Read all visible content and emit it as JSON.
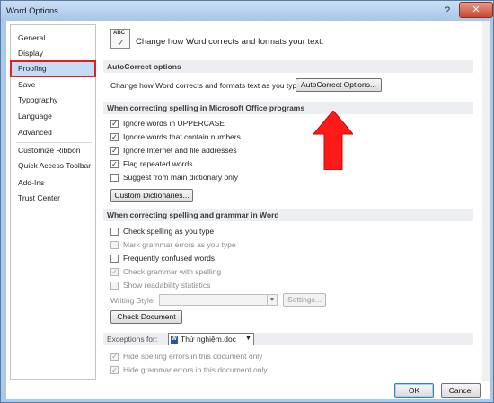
{
  "window": {
    "title": "Word Options",
    "help_glyph": "?",
    "close_glyph": "✕"
  },
  "nav": {
    "items": [
      {
        "label": "General"
      },
      {
        "label": "Display"
      },
      {
        "label": "Proofing"
      },
      {
        "label": "Save"
      },
      {
        "label": "Typography"
      },
      {
        "label": "Language"
      },
      {
        "label": "Advanced"
      },
      {
        "label": "Customize Ribbon"
      },
      {
        "label": "Quick Access Toolbar"
      },
      {
        "label": "Add-Ins"
      },
      {
        "label": "Trust Center"
      }
    ],
    "selected": "Proofing"
  },
  "header": {
    "icon_text": "ABC",
    "title": "Change how Word corrects and formats your text."
  },
  "autocorrect": {
    "section_title": "AutoCorrect options",
    "description": "Change how Word corrects and formats text as you type:",
    "button_label": "AutoCorrect Options..."
  },
  "office_spelling": {
    "section_title": "When correcting spelling in Microsoft Office programs",
    "options": [
      {
        "label": "Ignore words in UPPERCASE",
        "checked": true
      },
      {
        "label": "Ignore words that contain numbers",
        "checked": true
      },
      {
        "label": "Ignore Internet and file addresses",
        "checked": true
      },
      {
        "label": "Flag repeated words",
        "checked": true
      },
      {
        "label": "Suggest from main dictionary only",
        "checked": false
      }
    ],
    "button_label": "Custom Dictionaries..."
  },
  "word_spelling": {
    "section_title": "When correcting spelling and grammar in Word",
    "options": [
      {
        "label": "Check spelling as you type",
        "checked": false,
        "disabled": false
      },
      {
        "label": "Mark grammar errors as you type",
        "checked": false,
        "disabled": true
      },
      {
        "label": "Frequently confused words",
        "checked": false,
        "disabled": false
      },
      {
        "label": "Check grammar with spelling",
        "checked": true,
        "disabled": true
      },
      {
        "label": "Show readability statistics",
        "checked": false,
        "disabled": true
      }
    ],
    "writing_style_label": "Writing Style:",
    "writing_style_value": "",
    "settings_label": "Settings...",
    "check_document_label": "Check Document"
  },
  "exceptions": {
    "label": "Exceptions for:",
    "document": "Thử nghiệm.doc",
    "options": [
      {
        "label": "Hide spelling errors in this document only",
        "checked": true
      },
      {
        "label": "Hide grammar errors in this document only",
        "checked": true
      }
    ]
  },
  "footer": {
    "ok_label": "OK",
    "cancel_label": "Cancel"
  },
  "colors": {
    "highlight": "#e02020",
    "selected_nav": "#c6dcf5",
    "arrow": "#ff1a1a"
  },
  "icons": {
    "check": "✓",
    "dropdown": "▼"
  }
}
